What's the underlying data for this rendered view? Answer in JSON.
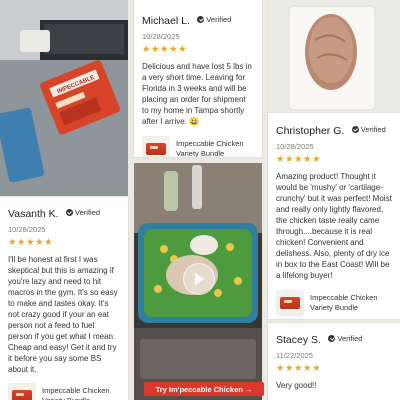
{
  "accent": {
    "star": "#e6a82a",
    "cta": "#d8392a"
  },
  "verified_label": "Verified",
  "stars": "★★★★★",
  "reviews": [
    {
      "name": "Michael L.",
      "date": "10/28/2025",
      "text": "Delicious and have lost 5 lbs in a very short time. Leaving for Florida in 3 weeks and will be placing an order for shipment to my home in Tampa shortly after I arrive. 😀",
      "product": "Impeccable Chicken Variety Bundle"
    },
    {
      "name": "Christopher G.",
      "date": "10/28/2025",
      "text": "Amazing product! Thought it would be 'mushy' or 'cartilage-crunchy' but it was perfect! Moist and really only lightly flavored, the chicken taste really came through....because it is real chicken! Convenient and delishess. Also, plenty of dry ice in box to the East Coast! Will be a lifelong buyer!",
      "product": "Impeccable Chicken Variety Bundle"
    },
    {
      "name": "Vasanth K.",
      "date": "10/28/2025",
      "text": "I'll be honest at first I was skeptical but this is amazing if you're lazy and need to hit macros in the gym. It's so easy to make and tastes okay. It's not crazy good if your an eat person not a feed to fuel person if you get what I mean. Cheap and easy! Get it and try it before you say some BS about it.",
      "product": "Impeccable Chicken Variety Bundle"
    },
    {
      "name": "Stacey S.",
      "date": "11/22/2025",
      "text": "Very good!!",
      "product": ""
    }
  ],
  "video": {
    "cta": "Try Im'peccable Chicken →"
  },
  "photo_desk": {
    "pack_label": "IMPECCABLE"
  }
}
